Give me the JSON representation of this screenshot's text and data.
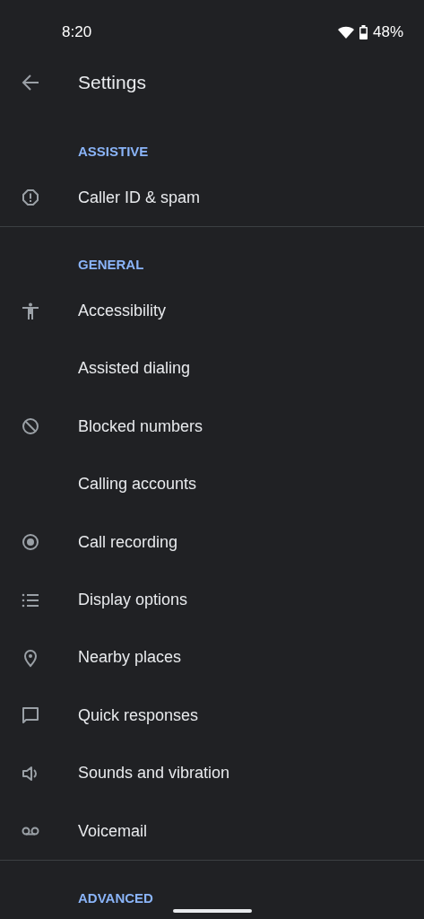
{
  "status_bar": {
    "time": "8:20",
    "battery": "48%"
  },
  "app_bar": {
    "title": "Settings"
  },
  "sections": [
    {
      "title": "ASSISTIVE",
      "items": [
        {
          "label": "Caller ID & spam"
        }
      ]
    },
    {
      "title": "GENERAL",
      "items": [
        {
          "label": "Accessibility"
        },
        {
          "label": "Assisted dialing"
        },
        {
          "label": "Blocked numbers"
        },
        {
          "label": "Calling accounts"
        },
        {
          "label": "Call recording"
        },
        {
          "label": "Display options"
        },
        {
          "label": "Nearby places"
        },
        {
          "label": "Quick responses"
        },
        {
          "label": "Sounds and vibration"
        },
        {
          "label": "Voicemail"
        }
      ]
    },
    {
      "title": "ADVANCED"
    }
  ]
}
